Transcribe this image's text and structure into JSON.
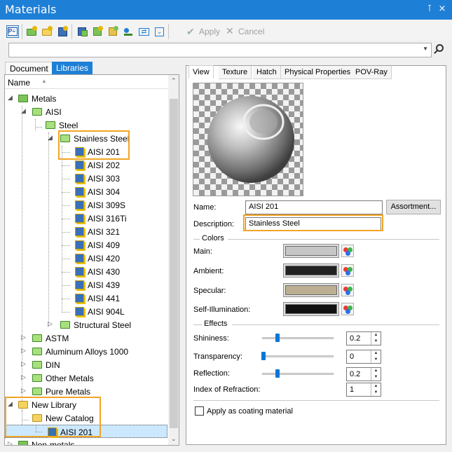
{
  "window": {
    "title": "Materials",
    "pin": "⊺",
    "close": "×"
  },
  "toolbar": {
    "apply_label": "Apply",
    "cancel_label": "Cancel"
  },
  "search": {
    "value": "",
    "placeholder": ""
  },
  "left_tabs": [
    "Document",
    "Libraries"
  ],
  "tree": {
    "header": "Name",
    "items": [
      {
        "label": "Metals"
      },
      {
        "label": "AISI"
      },
      {
        "label": "Steel"
      },
      {
        "label": "Stainless Steel"
      },
      {
        "label": "AISI 201"
      },
      {
        "label": "AISI 202"
      },
      {
        "label": "AISI 303"
      },
      {
        "label": "AISI 304"
      },
      {
        "label": "AISI 309S"
      },
      {
        "label": "AISI 316Ti"
      },
      {
        "label": "AISI 321"
      },
      {
        "label": "AISI 409"
      },
      {
        "label": "AISI 420"
      },
      {
        "label": "AISI 430"
      },
      {
        "label": "AISI 439"
      },
      {
        "label": "AISI 441"
      },
      {
        "label": "AISI 904L"
      },
      {
        "label": "Structural Steel"
      },
      {
        "label": "ASTM"
      },
      {
        "label": "Aluminum Alloys 1000"
      },
      {
        "label": "DIN"
      },
      {
        "label": "Other Metals"
      },
      {
        "label": "Pure Metals"
      },
      {
        "label": "New Library"
      },
      {
        "label": "New Catalog"
      },
      {
        "label": "AISI 201"
      },
      {
        "label": "Non-metals"
      }
    ]
  },
  "right_tabs": [
    "View",
    "Texture",
    "Hatch",
    "Physical Properties",
    "POV-Ray"
  ],
  "props": {
    "name_label": "Name:",
    "name_value": "AISI 201",
    "assortment_label": "Assortment...",
    "description_label": "Description:",
    "description_value": "Stainless Steel",
    "colors_group": "Colors",
    "main_label": "Main:",
    "ambient_label": "Ambient:",
    "specular_label": "Specular:",
    "selfillum_label": "Self-Illumination:",
    "colors": {
      "main": "#c6c6c6",
      "ambient": "#222222",
      "specular": "#bcae92",
      "self_illumination": "#111111"
    },
    "effects_group": "Effects",
    "shininess_label": "Shininess:",
    "shininess_value": "0.2",
    "transparency_label": "Transparency:",
    "transparency_value": "0",
    "reflection_label": "Reflection:",
    "reflection_value": "0.2",
    "ior_label": "Index of Refraction:",
    "ior_value": "1",
    "coating_label": "Apply as coating material"
  },
  "accent": {
    "titlebar": "#1e7fd6",
    "highlight": "#f2a524",
    "selection": "#cce8ff"
  }
}
